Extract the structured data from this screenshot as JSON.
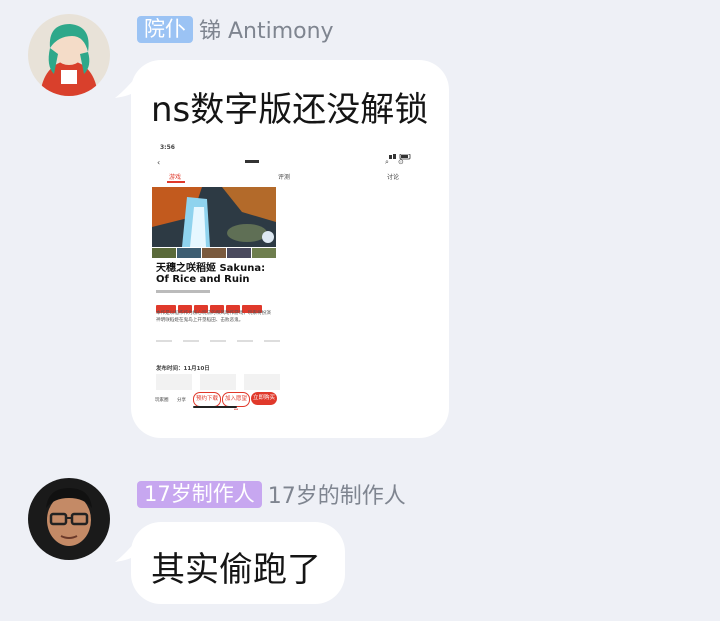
{
  "messages": [
    {
      "badge": "院仆",
      "badge_color": "#9bc3f4",
      "nickname": "锑 Antimony",
      "text": "ns数字版还没解锁",
      "avatar_icon": "anime-girl-avatar",
      "screenshot": {
        "time": "3:56",
        "tabs": [
          "游戏",
          "评测",
          "讨论"
        ],
        "game_title_cn": "天穗之咲稻姬 Sakuna:",
        "game_title_en": "Of Rice and Ruin",
        "description": "本作是以稻作作为核心玩法的和风动作游戏，玩家将扮演神明咲稻姬在鬼岛上开垦稻田、击败恶鬼。",
        "release_label": "发布时间：11月10日",
        "bottom_actions": [
          "玩家圈",
          "分享"
        ],
        "buttons": [
          "立即购买",
          "加入愿望单",
          "预约下载"
        ]
      }
    },
    {
      "badge": "17岁制作人",
      "badge_color": "#c7a7f0",
      "nickname": "17岁的制作人",
      "text": "其实偷跑了",
      "avatar_icon": "man-with-glasses-avatar"
    }
  ]
}
